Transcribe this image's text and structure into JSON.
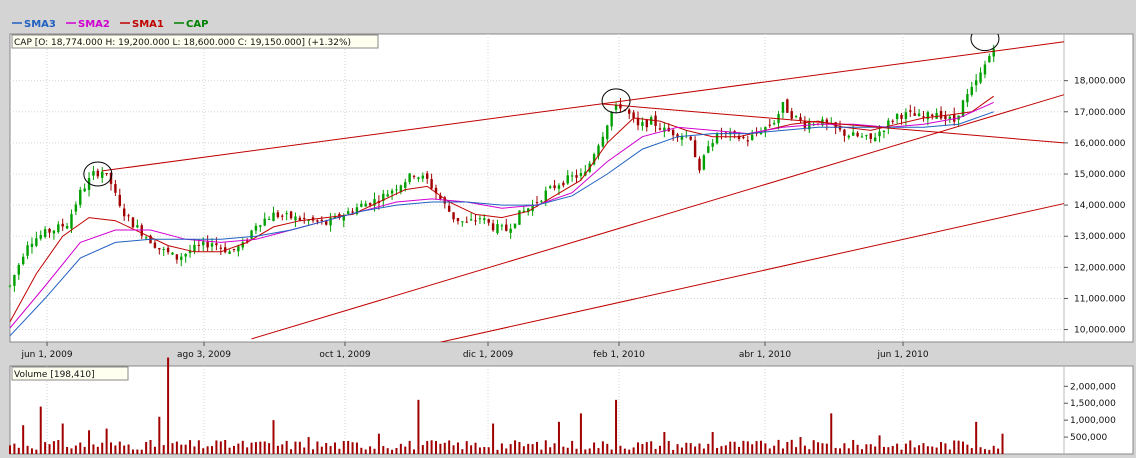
{
  "legend": [
    {
      "name": "SMA3",
      "color": "#2060c0"
    },
    {
      "name": "SMA2",
      "color": "#d000d0"
    },
    {
      "name": "SMA1",
      "color": "#c00000"
    },
    {
      "name": "CAP",
      "color": "#008000"
    }
  ],
  "ohlc_label": "CAP [O: 18,774.000  H: 19,200.000  L: 18,600.000  C: 19,150.000] (+1.32%)",
  "volume_label": "Volume [198,410]",
  "chart_data": [
    {
      "type": "candlestick",
      "title": "",
      "xlabel": "",
      "ylabel": "",
      "x_ticks": [
        "jun 1, 2009",
        "ago 3, 2009",
        "oct 1, 2009",
        "dic 1, 2009",
        "feb 1, 2010",
        "abr 1, 2010",
        "jun 1, 2010"
      ],
      "y_ticks": [
        "10,000.000",
        "11,000.000",
        "12,000.000",
        "13,000.000",
        "14,000.000",
        "15,000.000",
        "16,000.000",
        "17,000.000",
        "18,000.000"
      ],
      "ylim": [
        9600,
        19500
      ],
      "grid": true,
      "up_color": "#00a000",
      "down_color": "#a00000",
      "price_path": [
        [
          0,
          11400
        ],
        [
          4,
          12800
        ],
        [
          8,
          13100
        ],
        [
          13,
          13400
        ],
        [
          16,
          14400
        ],
        [
          19,
          15000
        ],
        [
          21,
          15100
        ],
        [
          23,
          14700
        ],
        [
          25,
          13900
        ],
        [
          28,
          13400
        ],
        [
          31,
          13000
        ],
        [
          34,
          12600
        ],
        [
          38,
          12300
        ],
        [
          42,
          12600
        ],
        [
          46,
          12800
        ],
        [
          50,
          12500
        ],
        [
          53,
          12700
        ],
        [
          56,
          13400
        ],
        [
          60,
          13700
        ],
        [
          64,
          13600
        ],
        [
          68,
          13500
        ],
        [
          72,
          13400
        ],
        [
          76,
          13700
        ],
        [
          80,
          14000
        ],
        [
          84,
          14200
        ],
        [
          88,
          14600
        ],
        [
          92,
          15000
        ],
        [
          95,
          14800
        ],
        [
          98,
          14200
        ],
        [
          101,
          13600
        ],
        [
          104,
          13400
        ],
        [
          107,
          13600
        ],
        [
          110,
          13300
        ],
        [
          113,
          13200
        ],
        [
          116,
          13700
        ],
        [
          119,
          14000
        ],
        [
          122,
          14400
        ],
        [
          125,
          14700
        ],
        [
          128,
          14900
        ],
        [
          131,
          15000
        ],
        [
          133,
          15700
        ],
        [
          135,
          16300
        ],
        [
          137,
          17000
        ],
        [
          139,
          17200
        ],
        [
          141,
          16900
        ],
        [
          143,
          16500
        ],
        [
          146,
          16700
        ],
        [
          149,
          16400
        ],
        [
          152,
          16300
        ],
        [
          155,
          16200
        ],
        [
          157,
          15000
        ],
        [
          159,
          16000
        ],
        [
          162,
          16300
        ],
        [
          165,
          16200
        ],
        [
          168,
          16100
        ],
        [
          171,
          16400
        ],
        [
          174,
          16700
        ],
        [
          176,
          17200
        ],
        [
          178,
          16900
        ],
        [
          181,
          16600
        ],
        [
          184,
          16700
        ],
        [
          187,
          16500
        ],
        [
          190,
          16300
        ],
        [
          193,
          16200
        ],
        [
          196,
          16100
        ],
        [
          199,
          16500
        ],
        [
          202,
          16900
        ],
        [
          205,
          16900
        ],
        [
          208,
          16800
        ],
        [
          211,
          17000
        ],
        [
          213,
          16800
        ],
        [
          215,
          16700
        ],
        [
          217,
          17300
        ],
        [
          219,
          17700
        ],
        [
          221,
          18200
        ],
        [
          223,
          18800
        ],
        [
          224,
          19150
        ]
      ],
      "series": [
        {
          "name": "SMA1",
          "color": "#c00000",
          "values": [
            [
              0,
              10250
            ],
            [
              6,
              11800
            ],
            [
              12,
              13000
            ],
            [
              18,
              13600
            ],
            [
              24,
              13500
            ],
            [
              30,
              13100
            ],
            [
              36,
              12700
            ],
            [
              42,
              12500
            ],
            [
              48,
              12500
            ],
            [
              54,
              12800
            ],
            [
              60,
              13300
            ],
            [
              66,
              13500
            ],
            [
              72,
              13600
            ],
            [
              78,
              13700
            ],
            [
              84,
              14100
            ],
            [
              90,
              14500
            ],
            [
              95,
              14600
            ],
            [
              100,
              14100
            ],
            [
              106,
              13700
            ],
            [
              112,
              13600
            ],
            [
              118,
              13800
            ],
            [
              124,
              14300
            ],
            [
              130,
              14800
            ],
            [
              136,
              16000
            ],
            [
              142,
              16800
            ],
            [
              148,
              16700
            ],
            [
              154,
              16400
            ],
            [
              160,
              16200
            ],
            [
              166,
              16200
            ],
            [
              172,
              16400
            ],
            [
              178,
              16600
            ],
            [
              184,
              16700
            ],
            [
              190,
              16500
            ],
            [
              196,
              16400
            ],
            [
              202,
              16600
            ],
            [
              208,
              16800
            ],
            [
              214,
              16900
            ],
            [
              219,
              17000
            ],
            [
              224,
              17500
            ]
          ]
        },
        {
          "name": "SMA2",
          "color": "#d000d0",
          "values": [
            [
              0,
              10050
            ],
            [
              8,
              11400
            ],
            [
              16,
              12800
            ],
            [
              24,
              13200
            ],
            [
              32,
              13200
            ],
            [
              40,
              12900
            ],
            [
              48,
              12800
            ],
            [
              56,
              12900
            ],
            [
              64,
              13200
            ],
            [
              72,
              13500
            ],
            [
              80,
              13800
            ],
            [
              88,
              14100
            ],
            [
              96,
              14200
            ],
            [
              104,
              14100
            ],
            [
              112,
              13900
            ],
            [
              120,
              14000
            ],
            [
              128,
              14400
            ],
            [
              136,
              15400
            ],
            [
              144,
              16200
            ],
            [
              152,
              16500
            ],
            [
              160,
              16400
            ],
            [
              168,
              16300
            ],
            [
              176,
              16500
            ],
            [
              184,
              16600
            ],
            [
              192,
              16600
            ],
            [
              200,
              16500
            ],
            [
              208,
              16600
            ],
            [
              216,
              16800
            ],
            [
              224,
              17300
            ]
          ]
        },
        {
          "name": "SMA3",
          "color": "#2060c0",
          "values": [
            [
              0,
              9800
            ],
            [
              8,
              11000
            ],
            [
              16,
              12300
            ],
            [
              24,
              12800
            ],
            [
              32,
              12900
            ],
            [
              40,
              12900
            ],
            [
              48,
              12900
            ],
            [
              56,
              13000
            ],
            [
              64,
              13200
            ],
            [
              72,
              13500
            ],
            [
              80,
              13800
            ],
            [
              88,
              14000
            ],
            [
              96,
              14100
            ],
            [
              104,
              14100
            ],
            [
              112,
              14000
            ],
            [
              120,
              14000
            ],
            [
              128,
              14300
            ],
            [
              136,
              15000
            ],
            [
              144,
              15800
            ],
            [
              152,
              16200
            ],
            [
              160,
              16300
            ],
            [
              168,
              16300
            ],
            [
              176,
              16400
            ],
            [
              184,
              16500
            ],
            [
              192,
              16500
            ],
            [
              200,
              16500
            ],
            [
              208,
              16500
            ],
            [
              216,
              16600
            ],
            [
              224,
              17000
            ]
          ]
        }
      ],
      "annotations": [
        {
          "type": "trendline",
          "from": [
            21,
            15100
          ],
          "to": [
            240,
            19250
          ]
        },
        {
          "type": "trendline",
          "from": [
            135,
            17250
          ],
          "to": [
            240,
            16000
          ]
        },
        {
          "type": "trendline",
          "from": [
            55,
            9700
          ],
          "to": [
            240,
            17550
          ]
        },
        {
          "type": "trendline",
          "from": [
            95,
            9500
          ],
          "to": [
            240,
            14050
          ]
        },
        {
          "type": "ellipse",
          "at": [
            20,
            15000
          ]
        },
        {
          "type": "ellipse",
          "at": [
            138,
            17350
          ]
        },
        {
          "type": "ellipse",
          "at": [
            222,
            19350
          ]
        }
      ]
    },
    {
      "type": "bar",
      "title": "",
      "ylabel": "",
      "y_ticks": [
        "500,000",
        "1,000,000",
        "1,500,000",
        "2,000,000"
      ],
      "ylim": [
        0,
        2600000
      ],
      "color": "#a00000",
      "spikes": [
        [
          3,
          850000
        ],
        [
          7,
          1400000
        ],
        [
          12,
          900000
        ],
        [
          18,
          700000
        ],
        [
          22,
          750000
        ],
        [
          34,
          1100000
        ],
        [
          36,
          2850000
        ],
        [
          47,
          400000
        ],
        [
          56,
          350000
        ],
        [
          60,
          1000000
        ],
        [
          68,
          500000
        ],
        [
          84,
          600000
        ],
        [
          93,
          1600000
        ],
        [
          110,
          900000
        ],
        [
          125,
          950000
        ],
        [
          130,
          1200000
        ],
        [
          138,
          1600000
        ],
        [
          149,
          650000
        ],
        [
          160,
          650000
        ],
        [
          180,
          500000
        ],
        [
          187,
          1200000
        ],
        [
          198,
          550000
        ],
        [
          215,
          400000
        ],
        [
          220,
          950000
        ],
        [
          226,
          600000
        ]
      ]
    }
  ]
}
